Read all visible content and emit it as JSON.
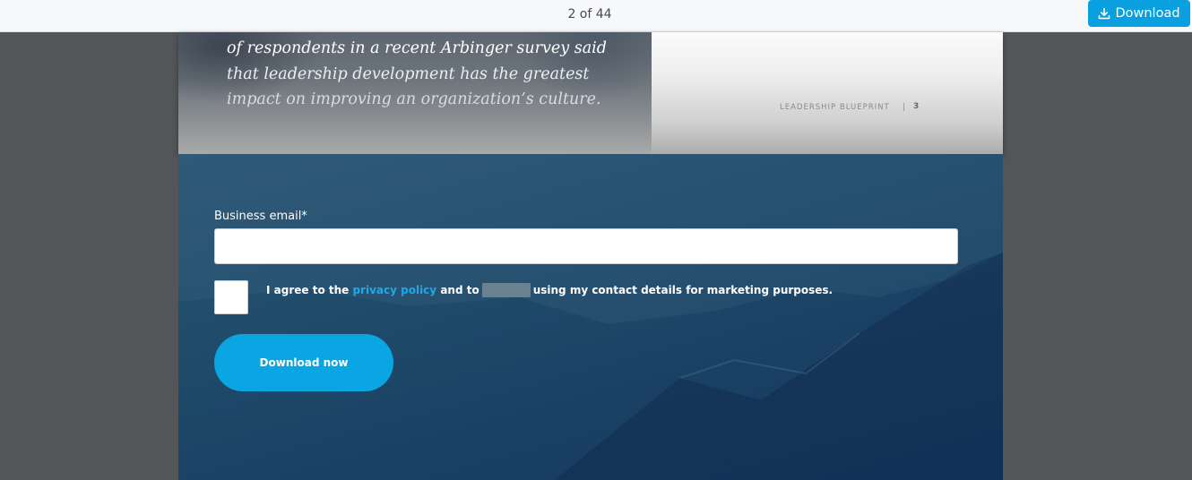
{
  "toolbar": {
    "page_indicator": "2 of 44",
    "download_label": "Download"
  },
  "document": {
    "quote_lines": [
      "of respondents in a recent Arbinger survey said",
      "that leadership development has the greatest",
      "impact on improving an organization’s culture."
    ],
    "footer_label": "LEADERSHIP BLUEPRINT",
    "footer_separator": "|",
    "page_number": "3"
  },
  "form": {
    "email_label": "Business email*",
    "email_value": "",
    "consent_prefix": "I agree to the",
    "privacy_link": "privacy policy",
    "consent_middle": "and to",
    "consent_suffix": "using my contact details for marketing purposes.",
    "submit_label": "Download now"
  },
  "colors": {
    "accent": "#0aa6e3",
    "link": "#1ea9e8",
    "panel": "#1f4a6a",
    "viewer_bg": "#525659"
  },
  "icons": {
    "download": "download-icon"
  }
}
